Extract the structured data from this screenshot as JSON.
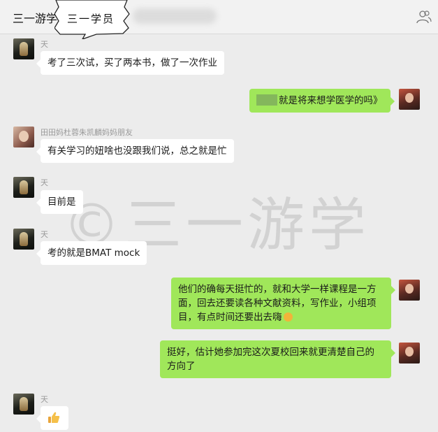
{
  "header": {
    "app_title": "三一游学",
    "group_label": "三一学员"
  },
  "watermark": "©三一游学",
  "messages": [
    {
      "sender": "天",
      "text": "考了三次试，买了两本书，做了一次作业"
    },
    {
      "text": "就是将来想学医学的吗》"
    },
    {
      "sender": "田田妈杜蓉朱凯麟妈妈朋友",
      "text": "有关学习的妞啥也没跟我们说，总之就是忙"
    },
    {
      "sender": "天",
      "text": "目前是"
    },
    {
      "sender": "天",
      "text": "考的就是BMAT mock"
    },
    {
      "lines": [
        "他们的确每天挺忙的，就和大学一样课程是一方",
        "面，回去还要读各种文献资料，写作业，小组项",
        "目，有点时间还要出去嗨"
      ]
    },
    {
      "lines": [
        "挺好，估计她参加完这次夏校回来就更清楚自己的",
        "方向了"
      ]
    },
    {
      "sender": "天",
      "emoji": "thumbs-up-icon"
    }
  ],
  "colors": {
    "outgoing_bubble": "#a0e75a",
    "incoming_bubble": "#ffffff",
    "background": "#ececec"
  }
}
